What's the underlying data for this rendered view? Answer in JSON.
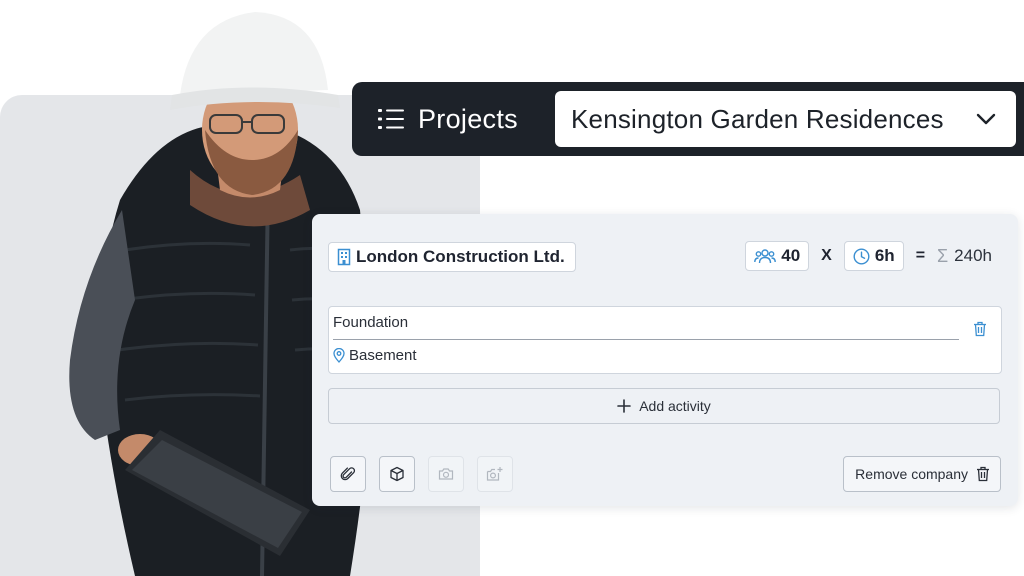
{
  "projects": {
    "label": "Projects",
    "selected_project": "Kensington Garden Residences"
  },
  "company": {
    "name": "London Construction Ltd.",
    "workers": "40",
    "multiply": "X",
    "hours": "6h",
    "equals": "=",
    "total": "240h"
  },
  "activity": {
    "name": "Foundation",
    "location": "Basement"
  },
  "actions": {
    "add_activity": "Add activity",
    "remove_company": "Remove company"
  },
  "colors": {
    "dark_bar": "#1d2229",
    "card_bg": "#eef1f5",
    "accent_icon": "#3b8fd1"
  }
}
